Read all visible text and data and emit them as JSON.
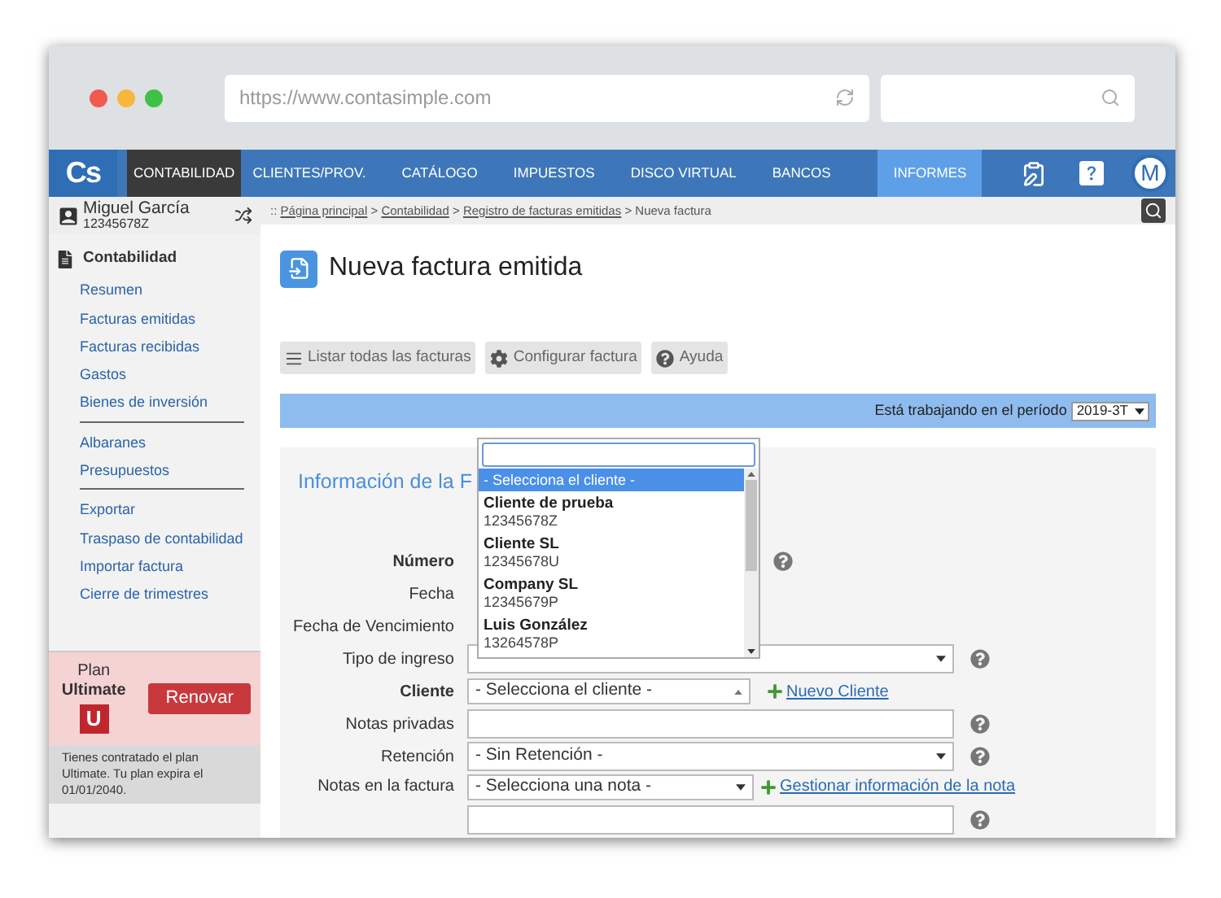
{
  "browser": {
    "url": "https://www.contasimple.com"
  },
  "nav": {
    "logo": "Cs",
    "items": [
      {
        "label": "CONTABILIDAD",
        "selected": true,
        "hover": false
      },
      {
        "label": "CLIENTES/PROV.",
        "selected": false,
        "hover": false
      },
      {
        "label": "CATÁLOGO",
        "selected": false,
        "hover": false
      },
      {
        "label": "IMPUESTOS",
        "selected": false,
        "hover": false
      },
      {
        "label": "DISCO VIRTUAL",
        "selected": false,
        "hover": false
      },
      {
        "label": "BANCOS",
        "selected": false,
        "hover": false
      },
      {
        "label": "INFORMES",
        "selected": false,
        "hover": true
      }
    ],
    "avatar": "M"
  },
  "user": {
    "name": "Miguel García",
    "id": "12345678Z"
  },
  "breadcrumb": {
    "prefix": "::",
    "items": [
      {
        "label": "Página principal",
        "link": true
      },
      {
        "label": "Contabilidad",
        "link": true
      },
      {
        "label": "Registro de facturas emitidas",
        "link": true
      },
      {
        "label": "Nueva factura",
        "link": false
      }
    ],
    "separator": ">"
  },
  "sidebar": {
    "section": "Contabilidad",
    "groups": [
      [
        "Resumen",
        "Facturas emitidas",
        "Facturas recibidas",
        "Gastos",
        "Bienes de inversión"
      ],
      [
        "Albaranes",
        "Presupuestos"
      ],
      [
        "Exportar",
        "Traspaso de contabilidad",
        "Importar factura",
        "Cierre de trimestres"
      ]
    ]
  },
  "plan": {
    "label": "Plan",
    "name": "Ultimate",
    "badge": "U",
    "button": "Renovar",
    "note": "Tienes contratado el plan Ultimate. Tu plan expira el 01/01/2040."
  },
  "page": {
    "title": "Nueva factura emitida"
  },
  "toolbar": [
    {
      "kind": "list",
      "label": "Listar todas las facturas"
    },
    {
      "kind": "settings",
      "label": "Configurar factura"
    },
    {
      "kind": "help",
      "label": "Ayuda"
    }
  ],
  "period": {
    "label": "Está trabajando en el período",
    "value": "2019-3T"
  },
  "form": {
    "heading": "Información de la F",
    "fields": [
      {
        "label": "Número",
        "bold": true,
        "kind": "covered",
        "help": true
      },
      {
        "label": "Fecha",
        "bold": false,
        "kind": "covered",
        "help": false
      },
      {
        "label": "Fecha de Vencimiento",
        "bold": false,
        "kind": "covered",
        "help": false
      },
      {
        "label": "Tipo de ingreso",
        "bold": false,
        "kind": "select",
        "help": true
      },
      {
        "label": "Cliente",
        "bold": true,
        "kind": "client",
        "value": "- Selecciona el cliente -",
        "link": "Nuevo Cliente",
        "help": false
      },
      {
        "label": "Notas privadas",
        "bold": false,
        "kind": "textarea",
        "help": true
      },
      {
        "label": "Retención",
        "bold": false,
        "kind": "select",
        "value": "- Sin Retención -",
        "help": true
      },
      {
        "label": "Notas en la factura",
        "bold": false,
        "kind": "note",
        "value": "- Selecciona una nota -",
        "link": "Gestionar información de la nota",
        "help": true
      }
    ]
  },
  "dropdown": {
    "options": [
      {
        "name": "- Selecciona el cliente -",
        "selected": true
      },
      {
        "name": "Cliente de prueba",
        "id": "12345678Z",
        "selected": false
      },
      {
        "name": "Cliente SL",
        "id": "12345678U",
        "selected": false
      },
      {
        "name": "Company SL",
        "id": "12345679P",
        "selected": false
      },
      {
        "name": "Luis González",
        "id": "13264578P",
        "selected": false
      }
    ]
  }
}
